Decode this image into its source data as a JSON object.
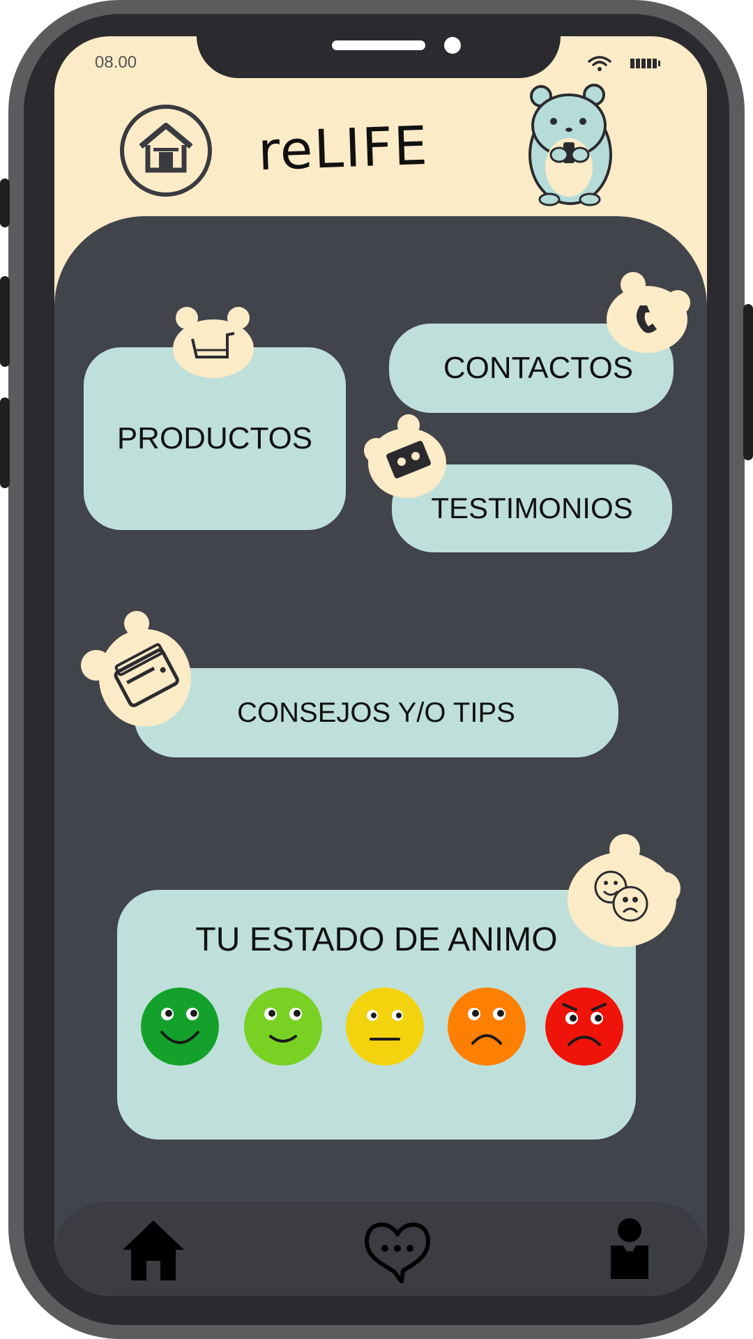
{
  "status_bar": {
    "time": "08.00"
  },
  "header": {
    "title": "reLIFE"
  },
  "menu": {
    "productos": "PRODUCTOS",
    "contactos": "CONTACTOS",
    "testimonios": "TESTIMONIOS",
    "consejos": "CONSEJOS Y/O TIPS"
  },
  "mood": {
    "title": "TU ESTADO DE ANIMO",
    "options": [
      {
        "icon": "very-happy-face-icon",
        "color": "#14a12b"
      },
      {
        "icon": "happy-face-icon",
        "color": "#79d124"
      },
      {
        "icon": "neutral-face-icon",
        "color": "#f3d20e"
      },
      {
        "icon": "sad-face-icon",
        "color": "#ff7f00"
      },
      {
        "icon": "angry-face-icon",
        "color": "#f01309"
      }
    ]
  },
  "nav": [
    "home-icon",
    "chat-heart-icon",
    "profile-icon"
  ],
  "colors": {
    "header_bg": "#fcebc7",
    "panel_bg": "#42444b",
    "card_bg": "#bfe0da",
    "badge_bg": "#fcebc7"
  }
}
